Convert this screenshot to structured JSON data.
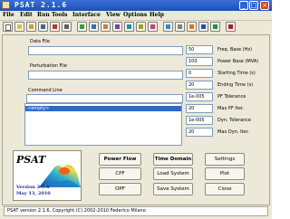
{
  "window": {
    "title": "PSAT 2.1.6"
  },
  "menu": [
    "File",
    "Edit",
    "Run",
    "Tools",
    "Interface",
    "View",
    "Options",
    "Help"
  ],
  "toolbar": {
    "icons": [
      "new-file-icon",
      "open-file-icon",
      "open-perturbation-icon",
      "save-icon",
      "close-file-icon",
      "settings-icon",
      "power-flow-icon",
      "continuation-icon",
      "opf-icon",
      "time-domain-icon",
      "small-signal-icon",
      "snb-icon",
      "lib-icon",
      "plot-icon",
      "report-icon",
      "theme-icon",
      "help-icon",
      "about-icon",
      "exit-icon"
    ]
  },
  "fields": {
    "data_file_label": "Data File",
    "perturbation_file_label": "Perturbation File",
    "command_line_label": "Command Line",
    "list_selected": "<empty>"
  },
  "params": [
    {
      "value": "50",
      "label": "Freq. Base (Hz)"
    },
    {
      "value": "100",
      "label": "Power Base (MVA)"
    },
    {
      "value": "0",
      "label": "Starting Time (s)"
    },
    {
      "value": "20",
      "label": "Ending Time (s)"
    },
    {
      "value": "1e-005",
      "label": "PF Tolerance"
    },
    {
      "value": "20",
      "label": "Max PF Iter."
    },
    {
      "value": "1e-005",
      "label": "Dyn. Tolerance"
    },
    {
      "value": "20",
      "label": "Max Dyn. Iter."
    }
  ],
  "logo": {
    "name": "PSAT",
    "version": "Version 2.1.6",
    "date": "May 13, 2010"
  },
  "buttons": {
    "power_flow": "Power Flow",
    "time_domain": "Time Domain",
    "settings": "Settings",
    "cpf": "CPF",
    "load_system": "Load System",
    "plot": "Plot",
    "opf": "OPF",
    "save_system": "Save System",
    "close": "Close"
  },
  "status": "PSAT version 2.1.6, Copyright (C) 2002-2010 Federico Milano",
  "colors": {
    "title_bar": "#1d4fb8",
    "selection": "#316ac5",
    "window_bg": "#ece9d8"
  }
}
